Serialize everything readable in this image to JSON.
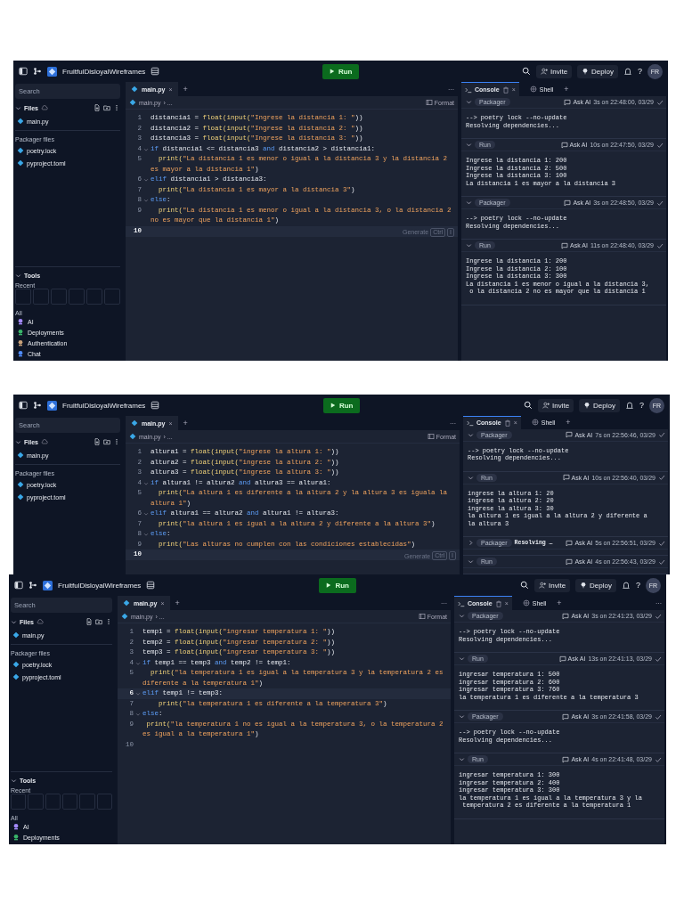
{
  "shots": [
    {
      "project": "FruitfulDisloyalWireframes",
      "run": "Run",
      "invite": "Invite",
      "deploy": "Deploy",
      "help": "?",
      "avatar": "FR",
      "sidebar": {
        "search": "Search",
        "files_label": "Files",
        "files": [
          "main.py"
        ],
        "packager_label": "Packager files",
        "packager_files": [
          "poetry.lock",
          "pyproject.toml"
        ],
        "tools": {
          "label": "Tools",
          "recent_label": "Recent",
          "all_label": "All",
          "items": [
            {
              "kind": "ai",
              "label": "AI"
            },
            {
              "kind": "deploy",
              "label": "Deployments"
            },
            {
              "kind": "auth",
              "label": "Authentication"
            },
            {
              "kind": "chat",
              "label": "Chat"
            }
          ]
        }
      },
      "editor": {
        "tab": "main.py",
        "close": "×",
        "add": "+",
        "more": "···",
        "breadcrumb": "main.py",
        "crumb_more": "› ...",
        "format": "Format",
        "lines": [
          {
            "n": "1",
            "fold": false,
            "active": false,
            "t": [
              {
                "text": "distancia1 = ",
                "kind": "plain"
              },
              {
                "text": "float(input(",
                "kind": "function"
              },
              {
                "text": "\"Ingrese la distancia 1: \"",
                "kind": "string"
              },
              {
                "text": "))",
                "kind": "plain"
              }
            ]
          },
          {
            "n": "2",
            "fold": false,
            "active": false,
            "t": [
              {
                "text": "distancia2 = ",
                "kind": "plain"
              },
              {
                "text": "float(input(",
                "kind": "function"
              },
              {
                "text": "\"Ingrese la distancia 2: \"",
                "kind": "string"
              },
              {
                "text": "))",
                "kind": "plain"
              }
            ]
          },
          {
            "n": "3",
            "fold": false,
            "active": false,
            "t": [
              {
                "text": "distancia3 = ",
                "kind": "plain"
              },
              {
                "text": "float(input(",
                "kind": "function"
              },
              {
                "text": "\"Ingrese la distancia 3: \"",
                "kind": "string"
              },
              {
                "text": "))",
                "kind": "plain"
              }
            ]
          },
          {
            "n": "4",
            "fold": true,
            "active": false,
            "t": [
              {
                "text": "if",
                "kind": "keyword"
              },
              {
                "text": " distancia1 <= distancia3 ",
                "kind": "plain"
              },
              {
                "text": "and",
                "kind": "keyword"
              },
              {
                "text": " distancia2 > distancia1:",
                "kind": "plain"
              }
            ]
          },
          {
            "n": "5",
            "fold": false,
            "active": false,
            "t": [
              {
                "text": "  print(",
                "kind": "function"
              },
              {
                "text": "\"La distancia 1 es menor o igual a la distancia 3 y la distancia 2 es mayor a la distancia 1\"",
                "kind": "string"
              },
              {
                "text": ")",
                "kind": "plain"
              }
            ]
          },
          {
            "n": "6",
            "fold": true,
            "active": false,
            "t": [
              {
                "text": "elif",
                "kind": "keyword"
              },
              {
                "text": " distancia1 > distancia3:",
                "kind": "plain"
              }
            ]
          },
          {
            "n": "7",
            "fold": false,
            "active": false,
            "t": [
              {
                "text": "  print(",
                "kind": "function"
              },
              {
                "text": "\"La distancia 1 es mayor a la distancia 3\"",
                "kind": "string"
              },
              {
                "text": ")",
                "kind": "plain"
              }
            ]
          },
          {
            "n": "8",
            "fold": true,
            "active": false,
            "t": [
              {
                "text": "else",
                "kind": "keyword"
              },
              {
                "text": ":",
                "kind": "plain"
              }
            ]
          },
          {
            "n": "9",
            "fold": false,
            "active": false,
            "t": [
              {
                "text": "  print(",
                "kind": "function"
              },
              {
                "text": "\"La distancia 1 es menor o igual a la distancia 3, o la distancia 2 no es mayor que la distancia 1\"",
                "kind": "string"
              },
              {
                "text": ")",
                "kind": "plain"
              }
            ]
          },
          {
            "n": "10",
            "fold": false,
            "active": true,
            "hint": {
              "text": "Generate",
              "keys": [
                "Ctrl",
                "I"
              ]
            }
          }
        ]
      },
      "console": {
        "tab": "Console",
        "close": "×",
        "shell": "Shell",
        "add": "+",
        "blocks": [
          {
            "kind": "Packager",
            "expanded": true,
            "ask": "Ask AI",
            "time": "3s on 22:48:00, 03/29",
            "output": [
              "--> poetry lock --no-update",
              "Resolving dependencies..."
            ]
          },
          {
            "kind": "Run",
            "expanded": true,
            "ask": "Ask AI",
            "time": "10s on 22:47:50, 03/29",
            "output": [
              "Ingrese la distancia 1: 200",
              "Ingrese la distancia 2: 500",
              "Ingrese la distancia 3: 100",
              "La distancia 1 es mayor a la distancia 3"
            ]
          },
          {
            "kind": "Packager",
            "expanded": true,
            "ask": "Ask AI",
            "time": "3s on 22:48:50, 03/29",
            "output": [
              "--> poetry lock --no-update",
              "Resolving dependencies..."
            ]
          },
          {
            "kind": "Run",
            "expanded": true,
            "ask": "Ask AI",
            "time": "11s on 22:48:40, 03/29",
            "output": [
              "Ingrese la distancia 1: 200",
              "Ingrese la distancia 2: 100",
              "Ingrese la distancia 3: 300",
              "La distancia 1 es menor o igual a la distancia 3,",
              " o la distancia 2 no es mayor que la distancia 1"
            ]
          }
        ]
      }
    },
    {
      "project": "FruitfulDisloyalWireframes",
      "run": "Run",
      "invite": "Invite",
      "deploy": "Deploy",
      "help": "?",
      "avatar": "FR",
      "sidebar": {
        "search": "Search",
        "files_label": "Files",
        "files": [
          "main.py"
        ],
        "packager_label": "Packager files",
        "packager_files": [
          "poetry.lock",
          "pyproject.toml"
        ]
      },
      "editor": {
        "tab": "main.py",
        "close": "×",
        "add": "+",
        "more": "···",
        "breadcrumb": "main.py",
        "crumb_more": "› ...",
        "format": "Format",
        "lines": [
          {
            "n": "1",
            "fold": false,
            "active": false,
            "t": [
              {
                "text": "altura1 = ",
                "kind": "plain"
              },
              {
                "text": "float(input(",
                "kind": "function"
              },
              {
                "text": "\"ingrese la altura 1: \"",
                "kind": "string"
              },
              {
                "text": "))",
                "kind": "plain"
              }
            ]
          },
          {
            "n": "2",
            "fold": false,
            "active": false,
            "t": [
              {
                "text": "altura2 = ",
                "kind": "plain"
              },
              {
                "text": "float(input(",
                "kind": "function"
              },
              {
                "text": "\"ingrese la altura 2: \"",
                "kind": "string"
              },
              {
                "text": "))",
                "kind": "plain"
              }
            ]
          },
          {
            "n": "3",
            "fold": false,
            "active": false,
            "t": [
              {
                "text": "altura3 = ",
                "kind": "plain"
              },
              {
                "text": "float(input(",
                "kind": "function"
              },
              {
                "text": "\"ingrese la altura 3: \"",
                "kind": "string"
              },
              {
                "text": "))",
                "kind": "plain"
              }
            ]
          },
          {
            "n": "4",
            "fold": true,
            "active": false,
            "t": [
              {
                "text": "if",
                "kind": "keyword"
              },
              {
                "text": " altura1 != altura2 ",
                "kind": "plain"
              },
              {
                "text": "and",
                "kind": "keyword"
              },
              {
                "text": " altura3 == altura1:",
                "kind": "plain"
              }
            ]
          },
          {
            "n": "5",
            "fold": false,
            "active": false,
            "t": [
              {
                "text": "  print(",
                "kind": "function"
              },
              {
                "text": "\"La altura 1 es diferente a la altura 2 y la altura 3 es iguala la altura 1\"",
                "kind": "string"
              },
              {
                "text": ")",
                "kind": "plain"
              }
            ]
          },
          {
            "n": "6",
            "fold": true,
            "active": false,
            "t": [
              {
                "text": "elif",
                "kind": "keyword"
              },
              {
                "text": " altura1 == altura2 ",
                "kind": "plain"
              },
              {
                "text": "and",
                "kind": "keyword"
              },
              {
                "text": " altura1 != altura3:",
                "kind": "plain"
              }
            ]
          },
          {
            "n": "7",
            "fold": false,
            "active": false,
            "t": [
              {
                "text": "  print(",
                "kind": "function"
              },
              {
                "text": "\"la altura 1 es igual a la altura 2 y diferente a la altura 3\"",
                "kind": "string"
              },
              {
                "text": ")",
                "kind": "plain"
              }
            ]
          },
          {
            "n": "8",
            "fold": true,
            "active": false,
            "t": [
              {
                "text": "else",
                "kind": "keyword"
              },
              {
                "text": ":",
                "kind": "plain"
              }
            ]
          },
          {
            "n": "9",
            "fold": false,
            "active": false,
            "t": [
              {
                "text": "  print(",
                "kind": "function"
              },
              {
                "text": "\"Las alturas no cumplen con las condiciones establecidas\"",
                "kind": "string"
              },
              {
                "text": ")",
                "kind": "plain"
              }
            ]
          },
          {
            "n": "10",
            "fold": false,
            "active": true,
            "hint": {
              "text": "Generate",
              "keys": [
                "Ctrl",
                "I"
              ]
            }
          }
        ]
      },
      "console": {
        "tab": "Console",
        "close": "×",
        "shell": "Shell",
        "add": "+",
        "blocks": [
          {
            "kind": "Packager",
            "expanded": true,
            "ask": "Ask AI",
            "time": "7s on 22:56:46, 03/29",
            "output": [
              "--> poetry lock --no-update",
              "Resolving dependencies..."
            ]
          },
          {
            "kind": "Run",
            "expanded": true,
            "ask": "Ask AI",
            "time": "10s on 22:56:40, 03/29",
            "output": [
              "ingrese la altura 1: 20",
              "ingrese la altura 2: 20",
              "ingrese la altura 3: 30",
              "la altura 1 es igual a la altura 2 y diferente a",
              "la altura 3"
            ]
          },
          {
            "kind": "Packager",
            "expanded": false,
            "inline": "Resolving …",
            "ask": "Ask AI",
            "time": "5s on 22:56:51, 03/29"
          },
          {
            "kind": "Run",
            "expanded": true,
            "ask": "Ask AI",
            "time": "4s on 22:56:43, 03/29"
          }
        ]
      }
    },
    {
      "project": "FruitfulDisloyalWireframes",
      "run": "Run",
      "invite": "Invite",
      "deploy": "Deploy",
      "help": "?",
      "avatar": "FR",
      "sidebar": {
        "search": "Search",
        "files_label": "Files",
        "files": [
          "main.py"
        ],
        "packager_label": "Packager files",
        "packager_files": [
          "poetry.lock",
          "pyproject.toml"
        ],
        "tools": {
          "label": "Tools",
          "recent_label": "Recent",
          "all_label": "All",
          "items": [
            {
              "kind": "ai",
              "label": "AI"
            },
            {
              "kind": "deploy",
              "label": "Deployments"
            }
          ]
        }
      },
      "editor": {
        "tab": "main.py",
        "close": "×",
        "add": "+",
        "more": "···",
        "breadcrumb": "main.py",
        "crumb_more": "› ...",
        "format": "Format",
        "lines": [
          {
            "n": "1",
            "fold": false,
            "active": false,
            "t": [
              {
                "text": "temp1 = ",
                "kind": "plain"
              },
              {
                "text": "float(input(",
                "kind": "function"
              },
              {
                "text": "\"ingresar temperatura 1: \"",
                "kind": "string"
              },
              {
                "text": "))",
                "kind": "plain"
              }
            ]
          },
          {
            "n": "2",
            "fold": false,
            "active": false,
            "t": [
              {
                "text": "temp2 = ",
                "kind": "plain"
              },
              {
                "text": "float(input(",
                "kind": "function"
              },
              {
                "text": "\"ingresar temperatura 2: \"",
                "kind": "string"
              },
              {
                "text": "))",
                "kind": "plain"
              }
            ]
          },
          {
            "n": "3",
            "fold": false,
            "active": false,
            "t": [
              {
                "text": "temp3 = ",
                "kind": "plain"
              },
              {
                "text": "float(input(",
                "kind": "function"
              },
              {
                "text": "\"ingresar temperatura 3: \"",
                "kind": "string"
              },
              {
                "text": "))",
                "kind": "plain"
              }
            ]
          },
          {
            "n": "4",
            "fold": true,
            "active": false,
            "t": [
              {
                "text": "if",
                "kind": "keyword"
              },
              {
                "text": " temp1 == temp3 ",
                "kind": "plain"
              },
              {
                "text": "and",
                "kind": "keyword"
              },
              {
                "text": " temp2 != temp1:",
                "kind": "plain"
              }
            ]
          },
          {
            "n": "5",
            "fold": false,
            "active": false,
            "t": [
              {
                "text": "  print(",
                "kind": "function"
              },
              {
                "text": "\"la temperatura 1 es igual a la temperatura 3 y la temperatura 2 es diferente a la temperatura 1\"",
                "kind": "string"
              },
              {
                "text": ")",
                "kind": "plain"
              }
            ]
          },
          {
            "n": "6",
            "fold": true,
            "active": true,
            "t": [
              {
                "text": "elif",
                "kind": "keyword"
              },
              {
                "text": " temp1 != temp3:",
                "kind": "plain"
              }
            ]
          },
          {
            "n": "7",
            "fold": false,
            "active": false,
            "t": [
              {
                "text": "    print(",
                "kind": "function"
              },
              {
                "text": "\"la temperatura 1 es diferente a la temperatura 3\"",
                "kind": "string"
              },
              {
                "text": ")",
                "kind": "plain"
              }
            ]
          },
          {
            "n": "8",
            "fold": true,
            "active": false,
            "t": [
              {
                "text": "else",
                "kind": "keyword"
              },
              {
                "text": ":",
                "kind": "plain"
              }
            ]
          },
          {
            "n": "9",
            "fold": false,
            "active": false,
            "t": [
              {
                "text": " print(",
                "kind": "function"
              },
              {
                "text": "\"la temperatura 1 no es igual a la temperatura 3, o la temperatura 2 es igual a la temperatura 1\"",
                "kind": "string"
              },
              {
                "text": ")",
                "kind": "plain"
              }
            ]
          },
          {
            "n": "10",
            "fold": false,
            "active": false
          }
        ]
      },
      "console": {
        "tab": "Console",
        "close": "×",
        "shell": "Shell",
        "add": "+",
        "more": "···",
        "blocks": [
          {
            "kind": "Packager",
            "expanded": true,
            "ask": "Ask AI",
            "time": "3s on 22:41:23, 03/29",
            "output": [
              "--> poetry lock --no-update",
              "Resolving dependencies..."
            ]
          },
          {
            "kind": "Run",
            "expanded": true,
            "ask": "Ask AI",
            "time": "13s on 22:41:13, 03/29",
            "output": [
              "ingresar temperatura 1: 500",
              "ingresar temperatura 2: 600",
              "ingresar temperatura 3: 760",
              "la temperatura 1 es diferente a la temperatura 3"
            ]
          },
          {
            "kind": "Packager",
            "expanded": true,
            "ask": "Ask AI",
            "time": "3s on 22:41:58, 03/29",
            "output": [
              "--> poetry lock --no-update",
              "Resolving dependencies..."
            ]
          },
          {
            "kind": "Run",
            "expanded": true,
            "ask": "Ask AI",
            "time": "4s on 22:41:48, 03/29",
            "output": [
              "ingresar temperatura 1: 300",
              "ingresar temperatura 2: 400",
              "ingresar temperatura 3: 300",
              "la temperatura 1 es igual a la temperatura 3 y la",
              " temperatura 2 es diferente a la temperatura 1"
            ]
          }
        ]
      }
    }
  ]
}
